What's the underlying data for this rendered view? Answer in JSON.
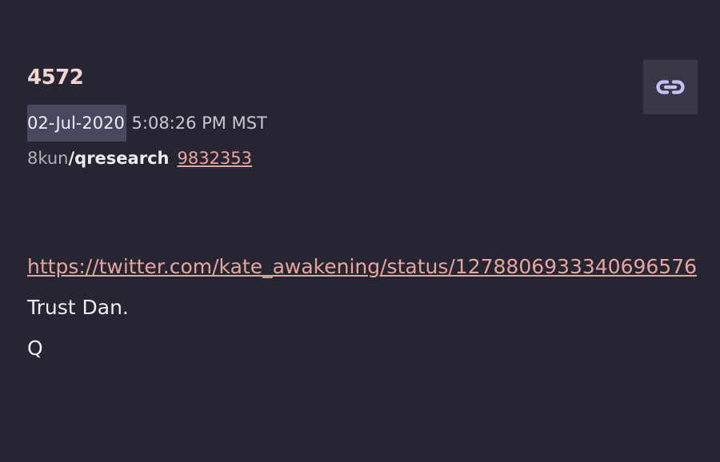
{
  "post": {
    "number": "4572",
    "date": "02-Jul-2020",
    "time": "5:08:26 PM MST",
    "source_site": "8kun",
    "source_board": "/qresearch",
    "source_post_id": "9832353",
    "link_icon": "link-icon",
    "body": {
      "url": "https://twitter.com/kate_awakening/status/1278806933340696576",
      "line1": "Trust Dan.",
      "line2": "Q"
    }
  },
  "colors": {
    "background": "#262633",
    "accent_link": "#e7a49e",
    "post_number": "#f3d4d1",
    "date_highlight": "#474760",
    "icon_button_bg": "#383847",
    "icon_color": "#c7c2f5"
  }
}
